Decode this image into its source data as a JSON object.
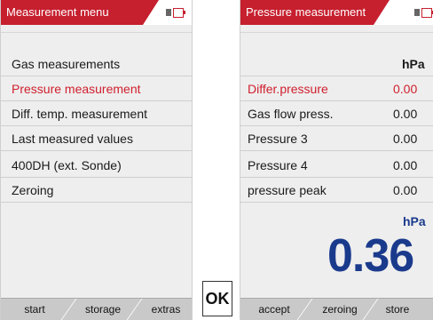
{
  "left_screen": {
    "title": "Measurement menu",
    "menu_items": [
      {
        "label": "Gas measurements"
      },
      {
        "label": "Pressure measurement",
        "selected": true
      },
      {
        "label": "Diff. temp. measurement"
      },
      {
        "label": "Last measured values"
      },
      {
        "label": "400DH (ext. Sonde)"
      },
      {
        "label": "Zeroing"
      }
    ],
    "softkeys": [
      "start",
      "storage",
      "extras"
    ]
  },
  "ok_button": "OK",
  "right_screen": {
    "title": "Pressure measurement",
    "unit_header": "hPa",
    "rows": [
      {
        "label": "Differ.pressure",
        "value": "0.00",
        "selected": true
      },
      {
        "label": "Gas flow press.",
        "value": "0.00"
      },
      {
        "label": "Pressure 3",
        "value": "0.00"
      },
      {
        "label": "Pressure 4",
        "value": "0.00"
      },
      {
        "label": "pressure peak",
        "value": "0.00"
      }
    ],
    "big_unit": "hPa",
    "big_value": "0.36",
    "softkeys": [
      "accept",
      "zeroing",
      "store"
    ]
  },
  "colors": {
    "title_bar": "#c61f2e",
    "selected_text": "#d0202e",
    "big_value": "#1a3a8c",
    "softkey_bar": "#c9c9c9"
  }
}
